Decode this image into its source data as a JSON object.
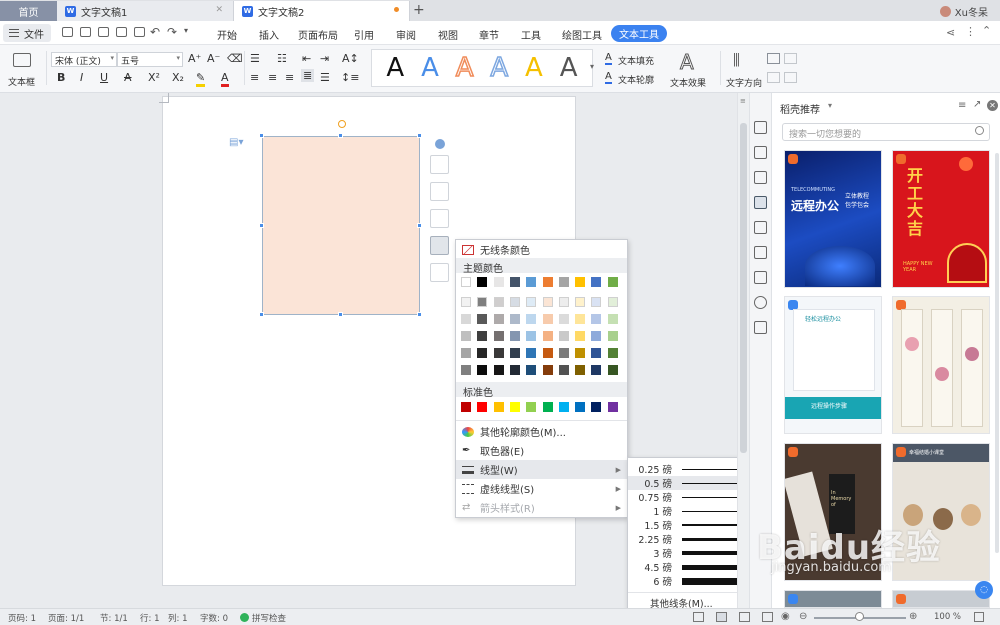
{
  "tabs": {
    "home": "首页",
    "doc1": "文字文稿1",
    "doc2": "文字文稿2",
    "user": "Xu冬呆",
    "doc_icon": "W"
  },
  "menu": {
    "file": "文件",
    "items": [
      "开始",
      "插入",
      "页面布局",
      "引用",
      "审阅",
      "视图",
      "章节",
      "工具",
      "绘图工具",
      "文本工具"
    ],
    "active_color": "#3b82f0"
  },
  "ribbon": {
    "textbox_label": "文本框",
    "font_name": "宋体 (正文)",
    "font_size": "五号",
    "style_glyph": "A",
    "style_colors": [
      "#111111",
      "#4a8ee8",
      "#f08c5a",
      "#7da7e0",
      "#f5c000",
      "#555555"
    ],
    "text_fill": "文本填充",
    "text_outline": "文本轮廓",
    "text_effect": "文本效果",
    "text_direction": "文字方向"
  },
  "context_menu": {
    "no_line": "无线条颜色",
    "theme_colors_title": "主题颜色",
    "standard_colors_title": "标准色",
    "more_colors": "其他轮廓颜色(M)...",
    "eyedropper": "取色器(E)",
    "line_type": "线型(W)",
    "dash_type": "虚线线型(S)",
    "arrow_style": "箭头样式(R)",
    "theme_top": [
      "#ffffff",
      "#000000",
      "#e7e6e6",
      "#44546a",
      "#5b9bd5",
      "#ed7d31",
      "#a5a5a5",
      "#ffc000",
      "#4472c4",
      "#70ad47"
    ],
    "theme_shades": [
      [
        "#f2f2f2",
        "#7f7f7f",
        "#d0cece",
        "#d6dce4",
        "#deebf6",
        "#fbe5d5",
        "#ededed",
        "#fff2cc",
        "#d9e2f3",
        "#e2efd9"
      ],
      [
        "#d8d8d8",
        "#595959",
        "#aeaaaa",
        "#adb9ca",
        "#bdd7ee",
        "#f7cbac",
        "#dbdbdb",
        "#fee599",
        "#b4c6e7",
        "#c5e0b3"
      ],
      [
        "#bfbfbf",
        "#3f3f3f",
        "#757070",
        "#8496b0",
        "#9cc3e5",
        "#f4b183",
        "#c9c9c9",
        "#ffd965",
        "#8eaadb",
        "#a8d08d"
      ],
      [
        "#a5a5a5",
        "#262626",
        "#3a3838",
        "#323f4f",
        "#2e75b5",
        "#c55a11",
        "#7b7b7b",
        "#bf9000",
        "#2f5496",
        "#538135"
      ],
      [
        "#7f7f7f",
        "#0c0c0c",
        "#171616",
        "#222a35",
        "#1e4e79",
        "#843c0b",
        "#525252",
        "#7f6000",
        "#1f3864",
        "#375623"
      ]
    ],
    "standard": [
      "#c00000",
      "#ff0000",
      "#ffc000",
      "#ffff00",
      "#92d050",
      "#00b050",
      "#00b0f0",
      "#0070c0",
      "#002060",
      "#7030a0"
    ]
  },
  "line_weights": {
    "items": [
      {
        "label": "0.25 磅",
        "weight": 0.25
      },
      {
        "label": "0.5 磅",
        "weight": 0.5
      },
      {
        "label": "0.75 磅",
        "weight": 0.75
      },
      {
        "label": "1 磅",
        "weight": 1
      },
      {
        "label": "1.5 磅",
        "weight": 1.5
      },
      {
        "label": "2.25 磅",
        "weight": 2.25
      },
      {
        "label": "3 磅",
        "weight": 3
      },
      {
        "label": "4.5 磅",
        "weight": 4.5
      },
      {
        "label": "6 磅",
        "weight": 6
      }
    ],
    "selected_index": 1,
    "more": "其他线条(M)..."
  },
  "panel": {
    "title": "稻壳推荐",
    "search_placeholder": "搜索一切您想要的",
    "tpl1_title": "远程办公",
    "tpl1_sub": "TELECOMMUTING",
    "tpl1_side": "立体教程 包学包会",
    "tpl2_title": "开工大吉",
    "tpl2_sub": "HAPPY NEW YEAR",
    "tpl3_title": "轻松远程办公",
    "tpl3_bottom": "远程操作步骤",
    "tpl5_title": "In Memory of",
    "tpl6_title": "幸福结婚小课堂"
  },
  "status": {
    "page_no": "页码: 1",
    "pages": "页面: 1/1",
    "section": "节: 1/1",
    "row": "行: 1",
    "col": "列: 1",
    "words": "字数: 0",
    "spell": "拼写检查",
    "zoom": "100 %"
  },
  "watermark": {
    "text": "Baidu经验",
    "url": "jingyan.baidu.com"
  }
}
